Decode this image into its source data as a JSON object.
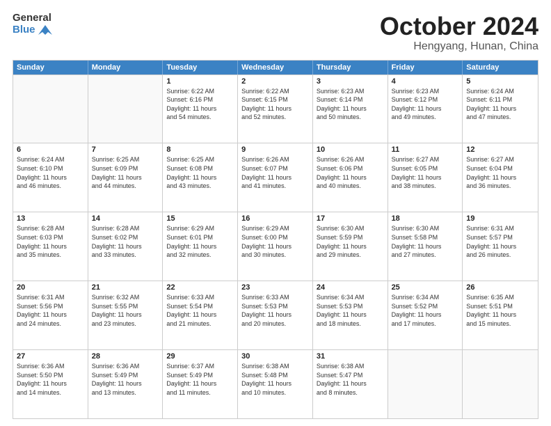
{
  "header": {
    "logo_line1": "General",
    "logo_line2": "Blue",
    "month": "October 2024",
    "location": "Hengyang, Hunan, China"
  },
  "weekdays": [
    "Sunday",
    "Monday",
    "Tuesday",
    "Wednesday",
    "Thursday",
    "Friday",
    "Saturday"
  ],
  "rows": [
    [
      {
        "day": "",
        "lines": []
      },
      {
        "day": "",
        "lines": []
      },
      {
        "day": "1",
        "lines": [
          "Sunrise: 6:22 AM",
          "Sunset: 6:16 PM",
          "Daylight: 11 hours",
          "and 54 minutes."
        ]
      },
      {
        "day": "2",
        "lines": [
          "Sunrise: 6:22 AM",
          "Sunset: 6:15 PM",
          "Daylight: 11 hours",
          "and 52 minutes."
        ]
      },
      {
        "day": "3",
        "lines": [
          "Sunrise: 6:23 AM",
          "Sunset: 6:14 PM",
          "Daylight: 11 hours",
          "and 50 minutes."
        ]
      },
      {
        "day": "4",
        "lines": [
          "Sunrise: 6:23 AM",
          "Sunset: 6:12 PM",
          "Daylight: 11 hours",
          "and 49 minutes."
        ]
      },
      {
        "day": "5",
        "lines": [
          "Sunrise: 6:24 AM",
          "Sunset: 6:11 PM",
          "Daylight: 11 hours",
          "and 47 minutes."
        ]
      }
    ],
    [
      {
        "day": "6",
        "lines": [
          "Sunrise: 6:24 AM",
          "Sunset: 6:10 PM",
          "Daylight: 11 hours",
          "and 46 minutes."
        ]
      },
      {
        "day": "7",
        "lines": [
          "Sunrise: 6:25 AM",
          "Sunset: 6:09 PM",
          "Daylight: 11 hours",
          "and 44 minutes."
        ]
      },
      {
        "day": "8",
        "lines": [
          "Sunrise: 6:25 AM",
          "Sunset: 6:08 PM",
          "Daylight: 11 hours",
          "and 43 minutes."
        ]
      },
      {
        "day": "9",
        "lines": [
          "Sunrise: 6:26 AM",
          "Sunset: 6:07 PM",
          "Daylight: 11 hours",
          "and 41 minutes."
        ]
      },
      {
        "day": "10",
        "lines": [
          "Sunrise: 6:26 AM",
          "Sunset: 6:06 PM",
          "Daylight: 11 hours",
          "and 40 minutes."
        ]
      },
      {
        "day": "11",
        "lines": [
          "Sunrise: 6:27 AM",
          "Sunset: 6:05 PM",
          "Daylight: 11 hours",
          "and 38 minutes."
        ]
      },
      {
        "day": "12",
        "lines": [
          "Sunrise: 6:27 AM",
          "Sunset: 6:04 PM",
          "Daylight: 11 hours",
          "and 36 minutes."
        ]
      }
    ],
    [
      {
        "day": "13",
        "lines": [
          "Sunrise: 6:28 AM",
          "Sunset: 6:03 PM",
          "Daylight: 11 hours",
          "and 35 minutes."
        ]
      },
      {
        "day": "14",
        "lines": [
          "Sunrise: 6:28 AM",
          "Sunset: 6:02 PM",
          "Daylight: 11 hours",
          "and 33 minutes."
        ]
      },
      {
        "day": "15",
        "lines": [
          "Sunrise: 6:29 AM",
          "Sunset: 6:01 PM",
          "Daylight: 11 hours",
          "and 32 minutes."
        ]
      },
      {
        "day": "16",
        "lines": [
          "Sunrise: 6:29 AM",
          "Sunset: 6:00 PM",
          "Daylight: 11 hours",
          "and 30 minutes."
        ]
      },
      {
        "day": "17",
        "lines": [
          "Sunrise: 6:30 AM",
          "Sunset: 5:59 PM",
          "Daylight: 11 hours",
          "and 29 minutes."
        ]
      },
      {
        "day": "18",
        "lines": [
          "Sunrise: 6:30 AM",
          "Sunset: 5:58 PM",
          "Daylight: 11 hours",
          "and 27 minutes."
        ]
      },
      {
        "day": "19",
        "lines": [
          "Sunrise: 6:31 AM",
          "Sunset: 5:57 PM",
          "Daylight: 11 hours",
          "and 26 minutes."
        ]
      }
    ],
    [
      {
        "day": "20",
        "lines": [
          "Sunrise: 6:31 AM",
          "Sunset: 5:56 PM",
          "Daylight: 11 hours",
          "and 24 minutes."
        ]
      },
      {
        "day": "21",
        "lines": [
          "Sunrise: 6:32 AM",
          "Sunset: 5:55 PM",
          "Daylight: 11 hours",
          "and 23 minutes."
        ]
      },
      {
        "day": "22",
        "lines": [
          "Sunrise: 6:33 AM",
          "Sunset: 5:54 PM",
          "Daylight: 11 hours",
          "and 21 minutes."
        ]
      },
      {
        "day": "23",
        "lines": [
          "Sunrise: 6:33 AM",
          "Sunset: 5:53 PM",
          "Daylight: 11 hours",
          "and 20 minutes."
        ]
      },
      {
        "day": "24",
        "lines": [
          "Sunrise: 6:34 AM",
          "Sunset: 5:53 PM",
          "Daylight: 11 hours",
          "and 18 minutes."
        ]
      },
      {
        "day": "25",
        "lines": [
          "Sunrise: 6:34 AM",
          "Sunset: 5:52 PM",
          "Daylight: 11 hours",
          "and 17 minutes."
        ]
      },
      {
        "day": "26",
        "lines": [
          "Sunrise: 6:35 AM",
          "Sunset: 5:51 PM",
          "Daylight: 11 hours",
          "and 15 minutes."
        ]
      }
    ],
    [
      {
        "day": "27",
        "lines": [
          "Sunrise: 6:36 AM",
          "Sunset: 5:50 PM",
          "Daylight: 11 hours",
          "and 14 minutes."
        ]
      },
      {
        "day": "28",
        "lines": [
          "Sunrise: 6:36 AM",
          "Sunset: 5:49 PM",
          "Daylight: 11 hours",
          "and 13 minutes."
        ]
      },
      {
        "day": "29",
        "lines": [
          "Sunrise: 6:37 AM",
          "Sunset: 5:49 PM",
          "Daylight: 11 hours",
          "and 11 minutes."
        ]
      },
      {
        "day": "30",
        "lines": [
          "Sunrise: 6:38 AM",
          "Sunset: 5:48 PM",
          "Daylight: 11 hours",
          "and 10 minutes."
        ]
      },
      {
        "day": "31",
        "lines": [
          "Sunrise: 6:38 AM",
          "Sunset: 5:47 PM",
          "Daylight: 11 hours",
          "and 8 minutes."
        ]
      },
      {
        "day": "",
        "lines": []
      },
      {
        "day": "",
        "lines": []
      }
    ]
  ]
}
